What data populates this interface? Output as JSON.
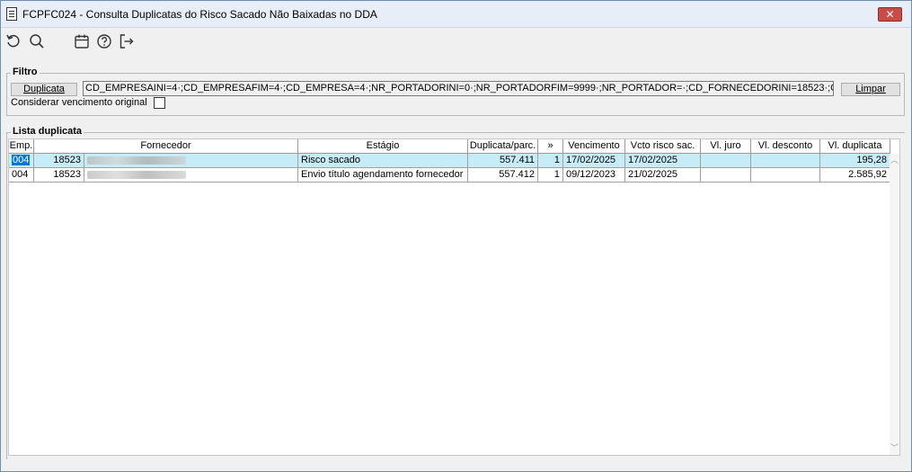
{
  "window": {
    "title": "FCPFC024 - Consulta Duplicatas do Risco Sacado Não Baixadas no DDA",
    "close_label": "✕"
  },
  "toolbar": {
    "buttons": [
      {
        "name": "refresh-icon"
      },
      {
        "name": "search-icon"
      },
      {
        "name": "calendar-icon"
      },
      {
        "name": "help-icon"
      },
      {
        "name": "exit-icon"
      }
    ]
  },
  "filter": {
    "legend": "Filtro",
    "duplicata_button": "Duplicata",
    "filter_text": "CD_EMPRESAINI=4·;CD_EMPRESAFIM=4·;CD_EMPRESA=4·;NR_PORTADORINI=0·;NR_PORTADORFIM=9999·;NR_PORTADOR=·;CD_FORNECEDORINI=18523·;CD_FORNECED",
    "clear_button": "Limpar",
    "checkbox_label": "Considerar vencimento original",
    "checkbox_checked": false
  },
  "list": {
    "legend": "Lista duplicata",
    "columns": [
      "Emp.",
      "Fornecedor",
      "Estágio",
      "Duplicata/parc.",
      "»",
      "Vencimento",
      "Vcto risco sac.",
      "Vl. juro",
      "Vl. desconto",
      "Vl. duplicata"
    ],
    "rows": [
      {
        "emp": "004",
        "fornecedor_cod": "18523",
        "estagio": "Risco sacado",
        "duplicata": "557.411",
        "parcela": "1",
        "vencimento": "17/02/2025",
        "vcto_risco": "17/02/2025",
        "juro": "",
        "desconto": "",
        "valor": "195,28",
        "selected": true
      },
      {
        "emp": "004",
        "fornecedor_cod": "18523",
        "estagio": "Envio título agendamento fornecedor",
        "duplicata": "557.412",
        "parcela": "1",
        "vencimento": "09/12/2023",
        "vcto_risco": "21/02/2025",
        "juro": "",
        "desconto": "",
        "valor": "2.585,92",
        "selected": false
      }
    ],
    "scroll_up": "︿",
    "scroll_down": "﹀"
  },
  "colors": {
    "selected_row": "#c6ecf8",
    "focus_cell": "#0078d7",
    "close_button": "#c94c46"
  }
}
